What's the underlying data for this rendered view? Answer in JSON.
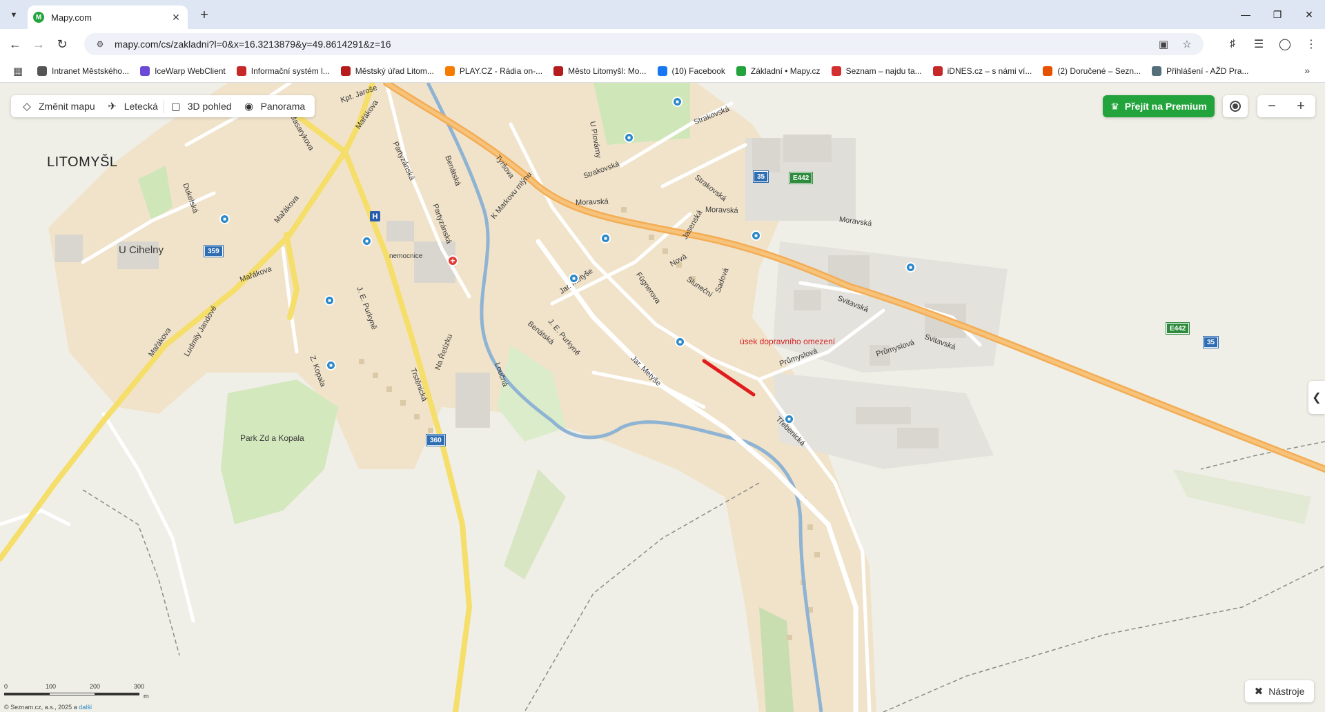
{
  "browser": {
    "tab_title": "Mapy.com",
    "tab_favicon_letter": "M",
    "url": "mapy.com/cs/zakladni?l=0&x=16.3213879&y=49.8614291&z=16"
  },
  "bookmarks": [
    {
      "label": "Intranet Městského...",
      "color": "#555555"
    },
    {
      "label": "IceWarp WebClient",
      "color": "#6a4ad6"
    },
    {
      "label": "Informační systém l...",
      "color": "#c62828"
    },
    {
      "label": "Městský úřad Litom...",
      "color": "#b71c1c"
    },
    {
      "label": "PLAY.CZ - Rádia on-...",
      "color": "#f57c00"
    },
    {
      "label": "Město Litomyšl: Mo...",
      "color": "#b71c1c"
    },
    {
      "label": "(10) Facebook",
      "color": "#1877f2"
    },
    {
      "label": "Základní • Mapy.cz",
      "color": "#23a33b"
    },
    {
      "label": "Seznam – najdu ta...",
      "color": "#d32f2f"
    },
    {
      "label": "iDNES.cz – s námi ví...",
      "color": "#c62828"
    },
    {
      "label": "(2) Doručené – Sezn...",
      "color": "#e65100"
    },
    {
      "label": "Přihlášení - AŽD Pra...",
      "color": "#546e7a"
    }
  ],
  "map_controls": {
    "change_map": "Změnit mapu",
    "aerial": "Letecká",
    "view_3d": "3D pohled",
    "panorama": "Panorama",
    "premium": "Přejít na Premium",
    "tools": "Nástroje"
  },
  "map": {
    "city": "LITOMYŠL",
    "area_label": "U Cihelny",
    "park_label": "Park Zd  a Kopala",
    "hospital_label": "nemocnice",
    "restriction_label": "úsek dopravního omezení",
    "street_labels": [
      "Moravská",
      "Moravská",
      "Moravská",
      "Strakovská",
      "Strakovská",
      "Strakovská",
      "Mařákova",
      "Mařákova",
      "Mařákova",
      "Mařákova",
      "Partyzánská",
      "Partyzánská",
      "Benátská",
      "Benátská",
      "J. E. Purkyně",
      "J. E. Purkyně",
      "Trstěnická",
      "Třebenická",
      "Jar. Metyše",
      "Jar. Metyše",
      "Průmyslová",
      "Průmyslová",
      "Svitavská",
      "Svitavská",
      "Tyršova",
      "Dukelská",
      "Masarykova",
      "Kpt. Jaroše",
      "Fügnerova",
      "Nová",
      "Sluneční",
      "Sadová",
      "Jasenská",
      "K Markovu mlýnu",
      "Na Řetízku",
      "Loučná",
      "Ludmily Jandové",
      "Z. Kopala",
      "U Plovárny"
    ],
    "shields": [
      {
        "text": "35",
        "kind": "national"
      },
      {
        "text": "E442",
        "kind": "euro"
      },
      {
        "text": "E442",
        "kind": "euro"
      },
      {
        "text": "35",
        "kind": "national"
      },
      {
        "text": "359",
        "kind": "national"
      },
      {
        "text": "360",
        "kind": "national"
      }
    ],
    "colors": {
      "primary_road": "#f4b25a",
      "secondary_road": "#f5e06a",
      "river": "#7fa9cf",
      "green": "#cfe6b8",
      "urban": "#f0e2c8",
      "restriction": "#e01d1d"
    }
  },
  "scale": {
    "ticks": [
      "0",
      "100",
      "200",
      "300"
    ],
    "unit": "m"
  },
  "copyright": {
    "text": "© Seznam.cz, a.s., 2025 a",
    "link": "další"
  }
}
